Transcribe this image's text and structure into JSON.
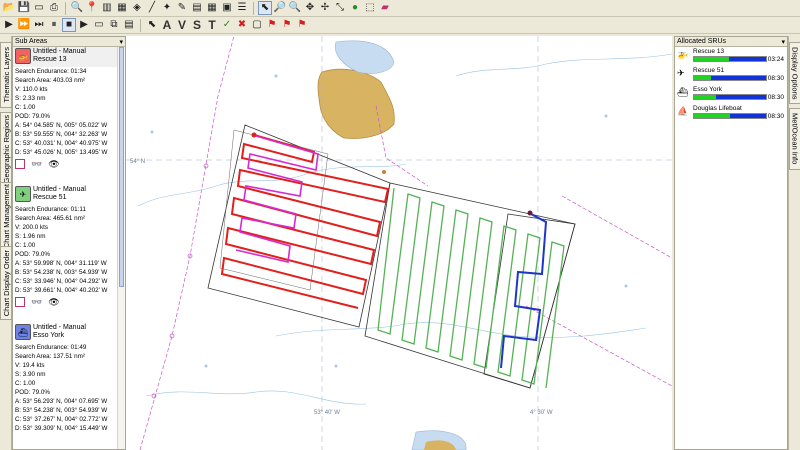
{
  "toolbar1": {
    "buttons": [
      "open-icon",
      "save-icon",
      "new-icon",
      "print-icon",
      "zoom-icon",
      "pin-icon",
      "chart-icon",
      "grid-icon",
      "tag-icon",
      "line-icon",
      "compass-icon",
      "edit-icon",
      "pdf-icon",
      "calendar-icon",
      "table-icon",
      "list-icon",
      "select-icon",
      "zoom-in-icon",
      "zoom-out-icon",
      "pan-icon",
      "move-icon",
      "measure-icon",
      "globe-icon",
      "ruler-icon",
      "erase-icon"
    ]
  },
  "toolbar2": {
    "letter_tools": [
      "A",
      "V",
      "S",
      "T"
    ]
  },
  "left_tabs": [
    "Thematic Layers",
    "Geographic Regions",
    "Chart Management",
    "Chart Display Order"
  ],
  "right_tabs": [
    "Display Options",
    "Met/Ocean Info"
  ],
  "sub_areas": {
    "title": "Sub Areas",
    "items": [
      {
        "name": "Untitled - Manual",
        "unit": "Rescue 13",
        "endurance": "Search Endurance: 01:34",
        "area": "Search Area: 403.03 nm²",
        "v": "V: 110.0 kts",
        "s": "S: 2.33 nm",
        "c": "C: 1.00",
        "pod": "POD: 79.0%",
        "a": "A: 54° 04.585' N, 005° 05.022' W",
        "b": "B: 53° 59.555' N, 004° 32.263' W",
        "cc": "C: 53° 40.031' N, 004° 40.975' W",
        "d": "D: 53° 45.026' N, 005° 13.495' W",
        "icon_color": "#e13a3a"
      },
      {
        "name": "Untitled - Manual",
        "unit": "Rescue 51",
        "endurance": "Search Endurance: 01:11",
        "area": "Search Area: 465.61 nm²",
        "v": "V: 200.0 kts",
        "s": "S: 1.96 nm",
        "c": "C: 1.00",
        "pod": "POD: 79.0%",
        "a": "A: 53° 59.998' N, 004° 31.119' W",
        "b": "B: 53° 54.238' N, 003° 54.939' W",
        "cc": "C: 53° 33.946' N, 004° 04.292' W",
        "d": "D: 53° 39.661' N, 004° 40.202' W",
        "icon_color": "#3cb84a"
      },
      {
        "name": "Untitled - Manual",
        "unit": "Esso York",
        "endurance": "Search Endurance: 01:49",
        "area": "Search Area: 137.51 nm²",
        "v": "V: 19.4 kts",
        "s": "S: 3.90 nm",
        "c": "C: 1.00",
        "pod": "POD: 79.0%",
        "a": "A: 53° 56.293' N, 004° 07.695' W",
        "b": "B: 53° 54.238' N, 003° 54.939' W",
        "cc": "C: 53° 37.267' N, 004° 02.772' W",
        "d": "D: 53° 39.309' N, 004° 15.449' W",
        "icon_color": "#3a55d8"
      }
    ]
  },
  "allocated_srus": {
    "title": "Allocated SRUs",
    "items": [
      {
        "name": "Rescue 13",
        "time": "03:24",
        "green": 0.48,
        "blue": 0.52,
        "icon": "helicopter-icon"
      },
      {
        "name": "Rescue 51",
        "time": "08:30",
        "green": 0.24,
        "blue": 0.76,
        "icon": "aircraft-icon"
      },
      {
        "name": "Esso York",
        "time": "08:30",
        "green": 0.3,
        "blue": 0.7,
        "icon": "ship-icon"
      },
      {
        "name": "Douglas Lifeboat",
        "time": "08:30",
        "green": 0.5,
        "blue": 0.5,
        "icon": "lifeboat-icon"
      }
    ]
  },
  "map": {
    "labels": [
      "54° N",
      "53° 40' W",
      "4° 30' W"
    ]
  }
}
